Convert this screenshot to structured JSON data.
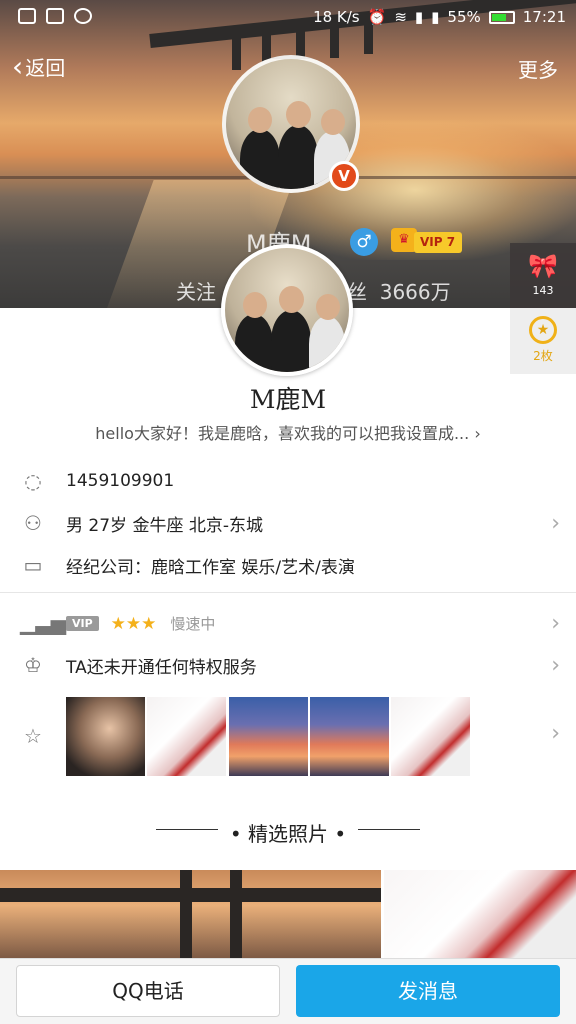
{
  "status_bar": {
    "speed": "18 K/s",
    "battery": "55%",
    "time": "17:21",
    "icons": [
      "message-icon",
      "image-icon",
      "vpn-icon",
      "alarm-icon",
      "wifi-icon",
      "signal-icon",
      "signal-icon",
      "battery-icon"
    ]
  },
  "nav": {
    "back_label": "返回",
    "more_label": "更多"
  },
  "hero": {
    "name": "M鹿M",
    "gender_symbol": "♂",
    "vip_label": "VIP 7",
    "follow_label": "关注",
    "fans_label": "丝",
    "fans_count": "3666万",
    "verified_label": "V"
  },
  "side": {
    "gift_count": "143",
    "medal_label": "2枚"
  },
  "profile": {
    "name": "M鹿M",
    "bio": "hello大家好！我是鹿晗，喜欢我的可以把我设置成..."
  },
  "info": {
    "qq_number": "1459109901",
    "personal": "男  27岁  金牛座  北京-东城",
    "company": "经纪公司：鹿晗工作室 娱乐/艺术/表演"
  },
  "vip": {
    "tag": "VIP",
    "stars": "★★★",
    "speed_text": "慢速中"
  },
  "privilege": "TA还未开通任何特权服务",
  "photos": {
    "thumbs": [
      "portrait-photo",
      "white-jacket-photo",
      "sunset-photo",
      "sunset-photo",
      "white-jacket-photo"
    ]
  },
  "section": {
    "title": "精选照片"
  },
  "buttons": {
    "call": "QQ电话",
    "message": "发消息"
  },
  "colors": {
    "accent": "#1aa6e8",
    "vip_gold": "#f7c92a",
    "verified": "#e24a1a"
  }
}
